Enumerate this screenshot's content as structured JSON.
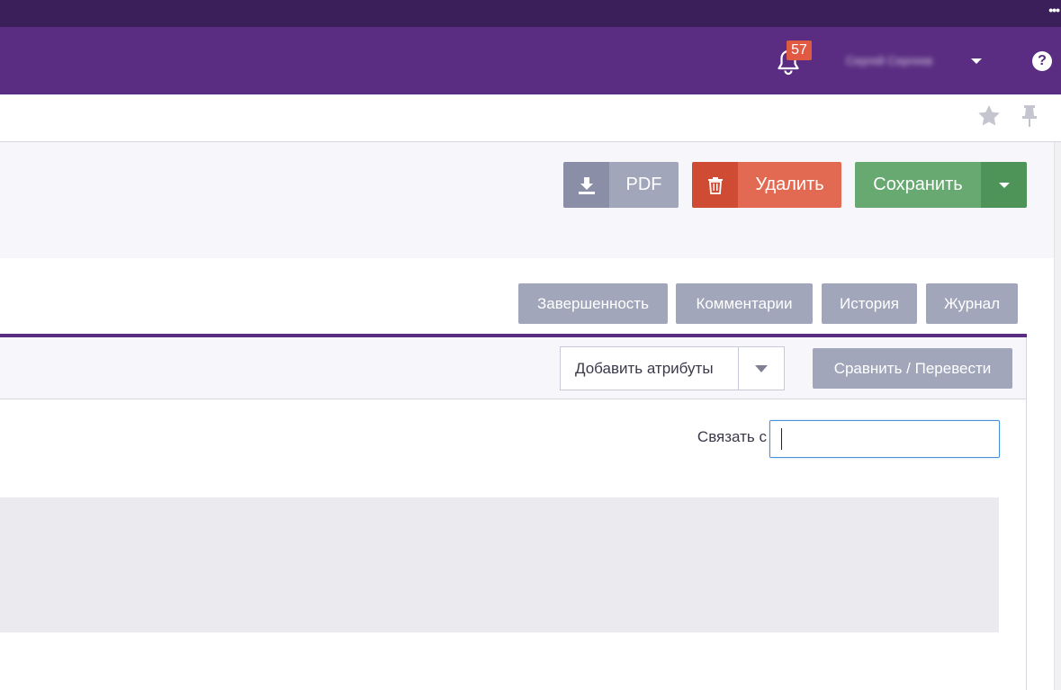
{
  "topstrip": {
    "menu_dots": "•••"
  },
  "navbar": {
    "notifications_count": "57",
    "user_name": "Сергей Сергеев",
    "help_label": "?"
  },
  "subbar": {
    "favorite_icon": "star-icon",
    "pin_icon": "pin-icon"
  },
  "actions": {
    "pdf_label": "PDF",
    "delete_label": "Удалить",
    "save_label": "Сохранить"
  },
  "tabs": [
    {
      "label": "Завершенность"
    },
    {
      "label": "Комментарии"
    },
    {
      "label": "История"
    },
    {
      "label": "Журнал"
    }
  ],
  "attributes": {
    "add_attributes_value": "Добавить атрибуты",
    "compare_label": "Сравнить / Перевести"
  },
  "link": {
    "label": "Связать с",
    "value": ""
  },
  "colors": {
    "brand_purple": "#5a2d82",
    "top_strip": "#3b1f5b",
    "badge": "#e05a43",
    "delete": "#e26a52",
    "save": "#67a971",
    "neutral_button": "#a2a6bb"
  }
}
